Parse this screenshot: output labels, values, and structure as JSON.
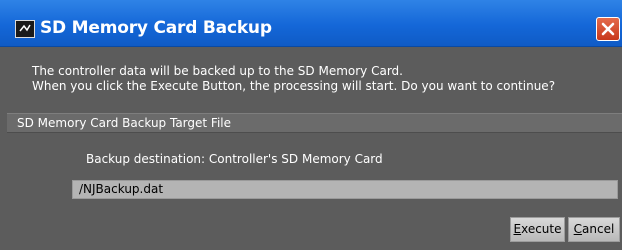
{
  "window": {
    "title": "SD Memory Card Backup",
    "app_icon": "sd-card-app-icon",
    "close_icon": "close-icon"
  },
  "message": {
    "line1": "The controller data will be backed up to the SD Memory Card.",
    "line2": "When you click the Execute Button, the processing will start. Do you want to continue?"
  },
  "target_file": {
    "section_title": "SD Memory Card Backup Target File",
    "destination_label": "Backup destination: Controller's SD Memory Card",
    "path_value": "/NJBackup.dat"
  },
  "buttons": {
    "execute_label": "Execute",
    "cancel_label": "Cancel"
  },
  "colors": {
    "titlebar": "#1467d8",
    "close_button": "#c8391c",
    "dialog_background": "#5c5c5c",
    "field_background": "#b4b4b4"
  }
}
